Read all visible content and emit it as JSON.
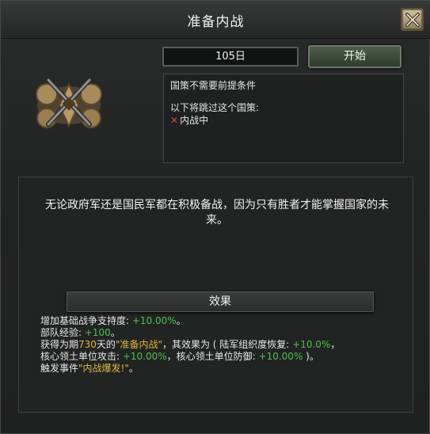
{
  "window": {
    "title": "准备内战"
  },
  "controls": {
    "timer": "105日",
    "start_label": "开始"
  },
  "icons": {
    "close": "close-x-icon",
    "focus": "crossed-swords-focus-icon"
  },
  "info": {
    "no_prereq": "国策不需要前提条件",
    "bypass_intro": "以下将跳过这个国策:",
    "bypass_item": "内战中"
  },
  "description": "无论政府军还是国民军都在积极备战，因为只有胜者才能掌握国家的未来。",
  "effects": {
    "header": "效果",
    "line1": {
      "prefix": "增加基础战争支持度: ",
      "value": "+10.00%",
      "suffix": "。"
    },
    "line2": {
      "prefix": "部队经验: ",
      "value": "+100",
      "suffix": "。"
    },
    "line3": {
      "prefix": "获得为期",
      "days": "730",
      "mid": "天的",
      "name": "\"准备内战\"",
      "rest": "，其效果为 ( 陆军组织度恢复: ",
      "value": "+10.0%",
      "end": "，"
    },
    "line4": {
      "prefix": "核心领土单位攻击: ",
      "value1": "+10.00%",
      "mid": "，核心领土单位防御: ",
      "value2": "+10.00%",
      "end": " )。"
    },
    "line5": {
      "prefix": "触发事件",
      "event": "\"内战爆发!\"",
      "end": "。"
    }
  },
  "colors": {
    "positive": "#4cc44c",
    "highlight": "#e0b83a",
    "negative": "#d5463c"
  }
}
